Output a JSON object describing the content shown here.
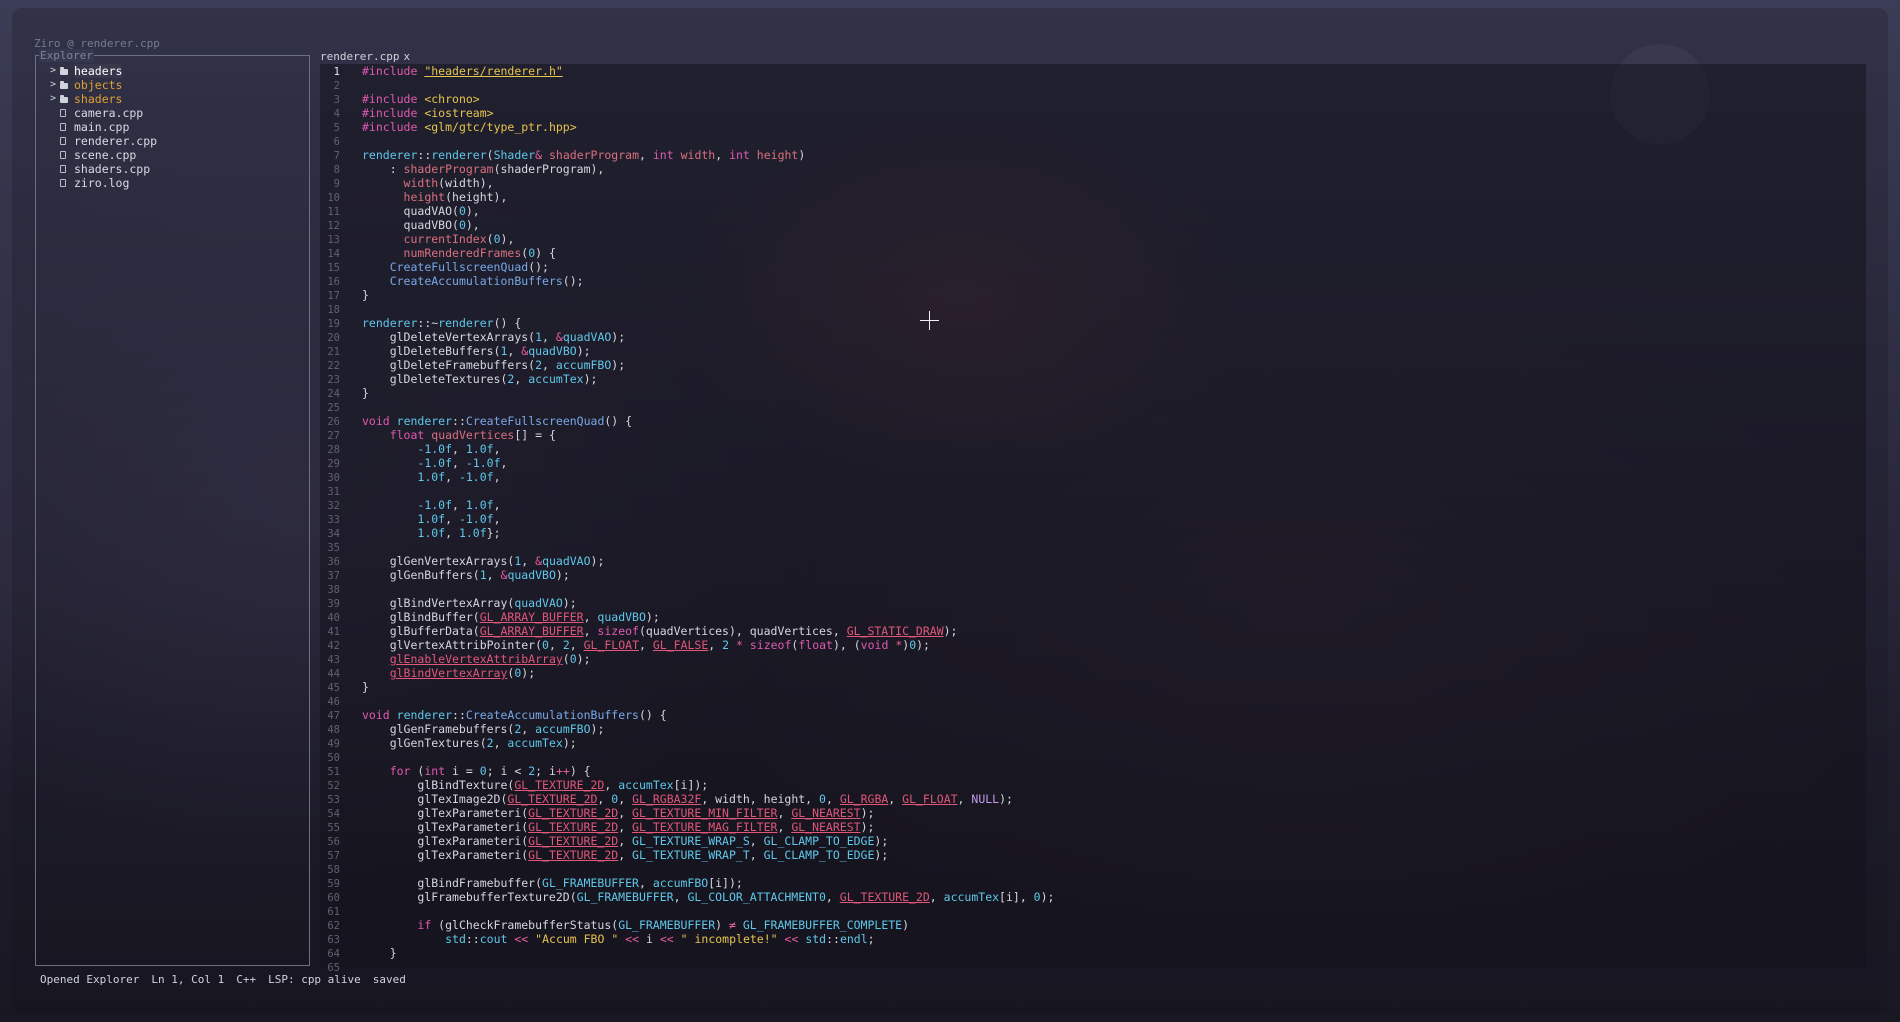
{
  "window_title": "Ziro @ renderer.cpp",
  "explorer": {
    "title": "Explorer",
    "items": [
      {
        "name": "headers",
        "kind": "folder",
        "expander": ">"
      },
      {
        "name": "objects",
        "kind": "folder",
        "expander": ">"
      },
      {
        "name": "shaders",
        "kind": "folder",
        "expander": ">"
      },
      {
        "name": "camera.cpp",
        "kind": "file"
      },
      {
        "name": "main.cpp",
        "kind": "file"
      },
      {
        "name": "renderer.cpp",
        "kind": "file"
      },
      {
        "name": "scene.cpp",
        "kind": "file"
      },
      {
        "name": "shaders.cpp",
        "kind": "file"
      },
      {
        "name": "ziro.log",
        "kind": "file"
      }
    ]
  },
  "tab": {
    "label": "renderer.cpp",
    "close": "x"
  },
  "code": {
    "lines": [
      "#include \"headers/renderer.h\"",
      "",
      "#include <chrono>",
      "#include <iostream>",
      "#include <glm/gtc/type_ptr.hpp>",
      "",
      "renderer::renderer(Shader& shaderProgram, int width, int height)",
      "    : shaderProgram(shaderProgram),",
      "      width(width),",
      "      height(height),",
      "      quadVAO(0),",
      "      quadVBO(0),",
      "      currentIndex(0),",
      "      numRenderedFrames(0) {",
      "    CreateFullscreenQuad();",
      "    CreateAccumulationBuffers();",
      "}",
      "",
      "renderer::~renderer() {",
      "    glDeleteVertexArrays(1, &quadVAO);",
      "    glDeleteBuffers(1, &quadVBO);",
      "    glDeleteFramebuffers(2, accumFBO);",
      "    glDeleteTextures(2, accumTex);",
      "}",
      "",
      "void renderer::CreateFullscreenQuad() {",
      "    float quadVertices[] = {",
      "        -1.0f, 1.0f,",
      "        -1.0f, -1.0f,",
      "        1.0f, -1.0f,",
      "",
      "        -1.0f, 1.0f,",
      "        1.0f, -1.0f,",
      "        1.0f, 1.0f};",
      "",
      "    glGenVertexArrays(1, &quadVAO);",
      "    glGenBuffers(1, &quadVBO);",
      "",
      "    glBindVertexArray(quadVAO);",
      "    glBindBuffer(GL_ARRAY_BUFFER, quadVBO);",
      "    glBufferData(GL_ARRAY_BUFFER, sizeof(quadVertices), quadVertices, GL_STATIC_DRAW);",
      "    glVertexAttribPointer(0, 2, GL_FLOAT, GL_FALSE, 2 * sizeof(float), (void *)0);",
      "    glEnableVertexAttribArray(0);",
      "    glBindVertexArray(0);",
      "}",
      "",
      "void renderer::CreateAccumulationBuffers() {",
      "    glGenFramebuffers(2, accumFBO);",
      "    glGenTextures(2, accumTex);",
      "",
      "    for (int i = 0; i < 2; i++) {",
      "        glBindTexture(GL_TEXTURE_2D, accumTex[i]);",
      "        glTexImage2D(GL_TEXTURE_2D, 0, GL_RGBA32F, width, height, 0, GL_RGBA, GL_FLOAT, NULL);",
      "        glTexParameteri(GL_TEXTURE_2D, GL_TEXTURE_MIN_FILTER, GL_NEAREST);",
      "        glTexParameteri(GL_TEXTURE_2D, GL_TEXTURE_MAG_FILTER, GL_NEAREST);",
      "        glTexParameteri(GL_TEXTURE_2D, GL_TEXTURE_WRAP_S, GL_CLAMP_TO_EDGE);",
      "        glTexParameteri(GL_TEXTURE_2D, GL_TEXTURE_WRAP_T, GL_CLAMP_TO_EDGE);",
      "",
      "        glBindFramebuffer(GL_FRAMEBUFFER, accumFBO[i]);",
      "        glFramebufferTexture2D(GL_FRAMEBUFFER, GL_COLOR_ATTACHMENT0, GL_TEXTURE_2D, accumTex[i], 0);",
      "",
      "        if (glCheckFramebufferStatus(GL_FRAMEBUFFER) ≠ GL_FRAMEBUFFER_COMPLETE)",
      "            std::cout << \"Accum FBO \" << i << \" incomplete!\" << std::endl;",
      "    }",
      ""
    ],
    "current_line": 1
  },
  "statusbar": {
    "message": "Opened Explorer",
    "position": "Ln 1, Col 1",
    "language": "C++",
    "lsp": "LSP: cpp alive",
    "save_state": "saved"
  },
  "colors": {
    "keyword": "#e05ab0",
    "type": "#5fc8ea",
    "function": "#79a8e8",
    "string": "#e6c44f",
    "member": "#d9707f",
    "folder_highlight": "#e0a030"
  }
}
